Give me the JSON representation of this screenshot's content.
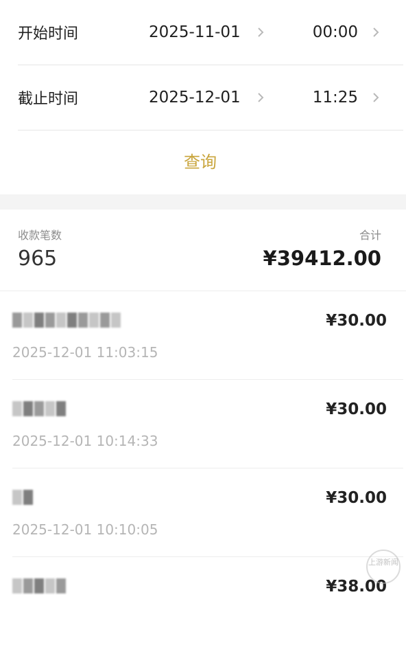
{
  "filter": {
    "start_label": "开始时间",
    "start_date": "2025-11-01",
    "start_time": "00:00",
    "end_label": "截止时间",
    "end_date": "2025-12-01",
    "end_time": "11:25",
    "query_label": "查询",
    "chevron_icon": "chevron-right-icon"
  },
  "summary": {
    "count_label": "收款笔数",
    "count_value": "965",
    "total_label": "合计",
    "total_value": "¥39412.00"
  },
  "transactions": [
    {
      "amount": "¥30.00",
      "time": "2025-12-01 11:03:15",
      "name_redacted": true
    },
    {
      "amount": "¥30.00",
      "time": "2025-12-01 10:14:33",
      "name_redacted": true
    },
    {
      "amount": "¥30.00",
      "time": "2025-12-01 10:10:05",
      "name_redacted": true
    },
    {
      "amount": "¥38.00",
      "time": "",
      "name_redacted": true
    }
  ],
  "watermark": {
    "text": "上游新闻"
  },
  "colors": {
    "accent": "#c9a53c",
    "muted_text": "#b5b5b5",
    "divider": "#ededed",
    "section_gap": "#f4f4f4"
  }
}
